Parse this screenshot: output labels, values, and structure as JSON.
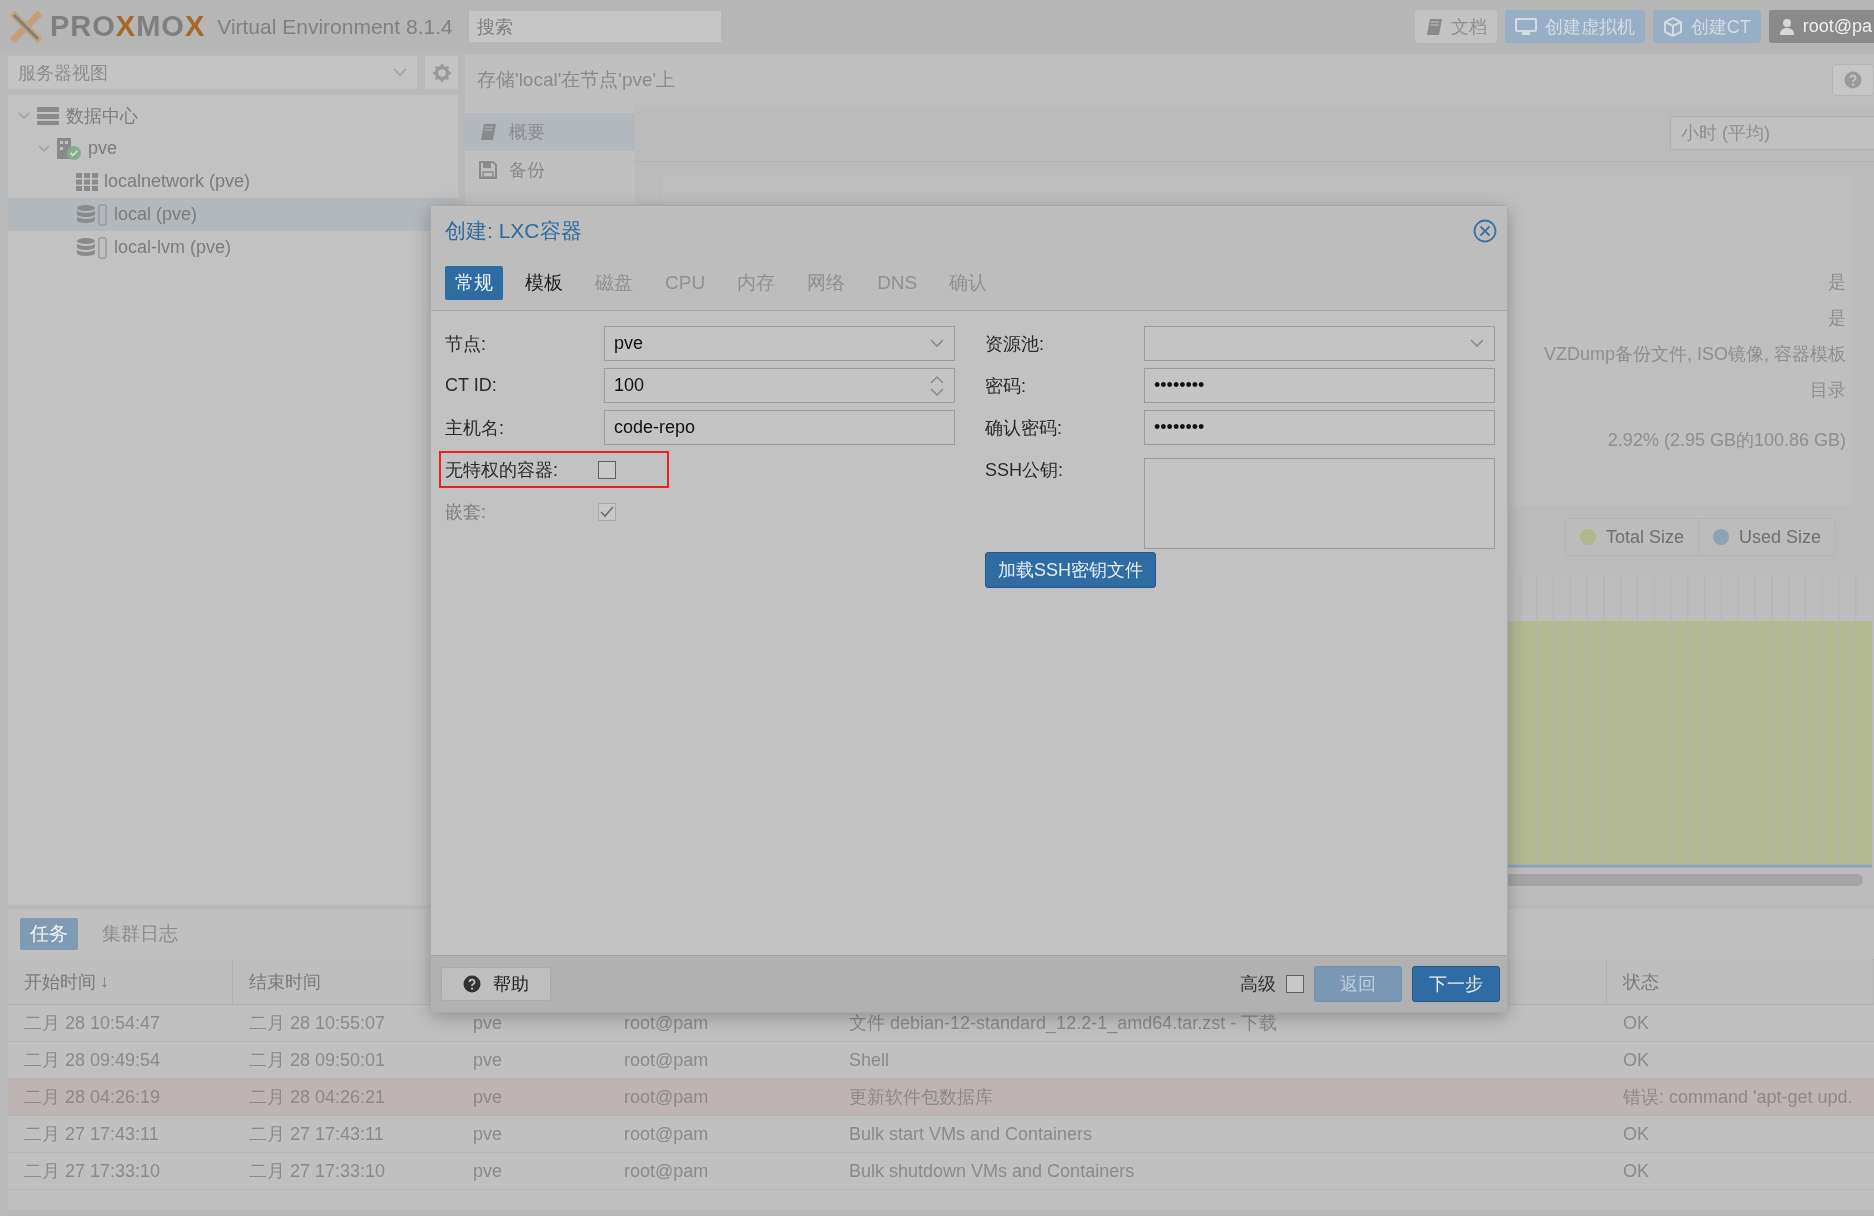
{
  "topbar": {
    "logo": [
      {
        "text": "PRO",
        "accent": false
      },
      {
        "text": "X",
        "accent": true
      },
      {
        "text": "MO",
        "accent": false
      },
      {
        "text": "X",
        "accent": true
      }
    ],
    "product": "Virtual Environment 8.1.4",
    "search": {
      "placeholder": "搜索"
    },
    "buttons": [
      {
        "label": "文档",
        "kind": "docs"
      },
      {
        "label": "创建虚拟机",
        "kind": "create-vm"
      },
      {
        "label": "创建CT",
        "kind": "create-ct"
      },
      {
        "label": "root@pa",
        "kind": "user"
      }
    ]
  },
  "sidebar": {
    "view_selector": {
      "value": "服务器视图"
    },
    "tree": [
      {
        "label": "数据中心",
        "kind": "datacenter",
        "expanded": true,
        "selected": false,
        "children": [
          {
            "label": "pve",
            "kind": "node",
            "expanded": true,
            "selected": false,
            "children": [
              {
                "label": "localnetwork (pve)",
                "kind": "network",
                "selected": false
              },
              {
                "label": "local (pve)",
                "kind": "storage",
                "selected": true
              },
              {
                "label": "local-lvm (pve)",
                "kind": "storage",
                "selected": false
              }
            ]
          }
        ]
      }
    ]
  },
  "content": {
    "title": "存储'local'在节点'pve'上",
    "nav": [
      {
        "label": "概要",
        "kind": "book",
        "selected": true
      },
      {
        "label": "备份",
        "kind": "floppy",
        "selected": false
      }
    ],
    "timeframe": {
      "value": "小时 (平均)"
    },
    "status_values": [
      "是",
      "是",
      "VZDump备份文件, ISO镜像, 容器模板",
      "目录",
      "2.92% (2.95 GB的100.86 GB)"
    ],
    "chart_legend": [
      {
        "label": "Total Size",
        "color": "#b0b88a"
      },
      {
        "label": "Used Size",
        "color": "#8ca2b8"
      }
    ]
  },
  "dialog": {
    "title": "创建: LXC容器",
    "tabs": [
      {
        "label": "常规",
        "selected": true,
        "disabled": false
      },
      {
        "label": "模板",
        "selected": false,
        "disabled": false
      },
      {
        "label": "磁盘",
        "selected": false,
        "disabled": true
      },
      {
        "label": "CPU",
        "selected": false,
        "disabled": true
      },
      {
        "label": "内存",
        "selected": false,
        "disabled": true
      },
      {
        "label": "网络",
        "selected": false,
        "disabled": true
      },
      {
        "label": "DNS",
        "selected": false,
        "disabled": true
      },
      {
        "label": "确认",
        "selected": false,
        "disabled": true
      }
    ],
    "left_fields": [
      {
        "kind": "combo",
        "label": "节点:",
        "value": "pve"
      },
      {
        "kind": "spinner",
        "label": "CT ID:",
        "value": "100"
      },
      {
        "kind": "text",
        "label": "主机名:",
        "value": "code-repo"
      },
      {
        "kind": "checkbox",
        "label": "无特权的容器:",
        "checked": false,
        "disabled": false,
        "highlighted": true
      },
      {
        "kind": "checkbox",
        "label": "嵌套:",
        "checked": true,
        "disabled": true,
        "highlighted": false
      }
    ],
    "right_fields": [
      {
        "kind": "combo",
        "label": "资源池:"
      },
      {
        "kind": "password",
        "label": "密码:",
        "value": "••••••••"
      },
      {
        "kind": "password",
        "label": "确认密码:",
        "value": "••••••••"
      },
      {
        "kind": "textarea",
        "label": "SSH公钥:"
      }
    ],
    "load_key_button": "加载SSH密钥文件",
    "footer": {
      "help": "帮助",
      "advanced": {
        "label": "高级",
        "checked": false
      },
      "back": {
        "label": "返回",
        "disabled": true
      },
      "next": {
        "label": "下一步",
        "disabled": false
      }
    }
  },
  "tasks": {
    "tabs": [
      {
        "label": "任务",
        "selected": true
      },
      {
        "label": "集群日志",
        "selected": false
      }
    ],
    "columns": [
      {
        "label": "开始时间",
        "sort_indicator": "↓"
      },
      {
        "label": "结束时间"
      },
      {},
      {},
      {},
      {
        "label": "状态"
      }
    ],
    "rows": [
      {
        "cells": [
          "二月 28 10:54:47",
          "二月 28 10:55:07",
          "pve",
          "root@pam",
          "文件 debian-12-standard_12.2-1_amd64.tar.zst - 下载",
          "OK"
        ],
        "error": false
      },
      {
        "cells": [
          "二月 28 09:49:54",
          "二月 28 09:50:01",
          "pve",
          "root@pam",
          "Shell",
          "OK"
        ],
        "error": false
      },
      {
        "cells": [
          "二月 28 04:26:19",
          "二月 28 04:26:21",
          "pve",
          "root@pam",
          "更新软件包数据库",
          "错误: command 'apt-get upd."
        ],
        "error": true
      },
      {
        "cells": [
          "二月 27 17:43:11",
          "二月 27 17:43:11",
          "pve",
          "root@pam",
          "Bulk start VMs and Containers",
          "OK"
        ],
        "error": false
      },
      {
        "cells": [
          "二月 27 17:33:10",
          "二月 27 17:33:10",
          "pve",
          "root@pam",
          "Bulk shutdown VMs and Containers",
          "OK"
        ],
        "error": false
      }
    ]
  }
}
